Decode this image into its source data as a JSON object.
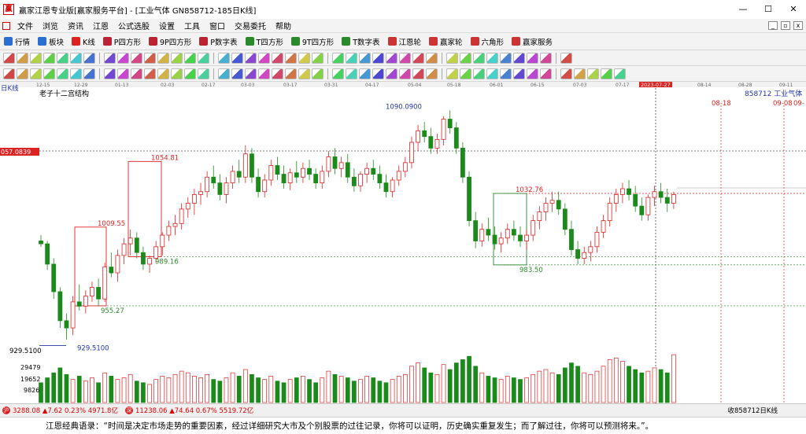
{
  "window": {
    "title": "赢家江恩专业版[赢家服务平台] - [工业气体  GN858712-185日K线]"
  },
  "menu": [
    "文件",
    "浏览",
    "资讯",
    "江恩",
    "公式选股",
    "设置",
    "工具",
    "窗口",
    "交易委托",
    "帮助"
  ],
  "toolbar": [
    {
      "label": "行情",
      "color": "#2a6fd1"
    },
    {
      "label": "板块",
      "color": "#2a6fd1"
    },
    {
      "label": "K线",
      "color": "#d22"
    },
    {
      "label": "P四方形",
      "color": "#b23"
    },
    {
      "label": "9P四方形",
      "color": "#b23"
    },
    {
      "label": "P数字表",
      "color": "#b23"
    },
    {
      "label": "T四方形",
      "color": "#2a8a2a"
    },
    {
      "label": "9T四方形",
      "color": "#2a8a2a"
    },
    {
      "label": "T数字表",
      "color": "#2a8a2a"
    },
    {
      "label": "江恩轮",
      "color": "#c33"
    },
    {
      "label": "赢家轮",
      "color": "#c33"
    },
    {
      "label": "六角形",
      "color": "#c33"
    },
    {
      "label": "赢家服务",
      "color": "#c33"
    }
  ],
  "chart_data": {
    "type": "candlestick",
    "period_label": "日K线",
    "indicator_title": "老子十二宫结构",
    "symbol_info": "858712  工业气体",
    "date_ticks": [
      "12-15",
      "12-29",
      "01-13",
      "02-03",
      "02-17",
      "03-03",
      "03-17",
      "03-31",
      "04-17",
      "05-04",
      "05-18",
      "06-01",
      "06-15",
      "07-03",
      "07-17",
      "2023-07-27",
      "08-14",
      "08-28",
      "09-11"
    ],
    "future_labels": [
      "08-18",
      "09-08",
      "09-"
    ],
    "price_scale": {
      "min": 920,
      "max": 1100
    },
    "volume_ticks": [
      "29479",
      "19652",
      "9826"
    ],
    "axis_tags": {
      "price_cursor": "057.0839",
      "low_label": "929.5100"
    },
    "annotations": [
      {
        "text": "1090.0900",
        "value": 1090.09,
        "color": "#2233aa"
      },
      {
        "text": "1054.81",
        "value": 1054.81,
        "color": "#d22"
      },
      {
        "text": "1032.76",
        "value": 1032.76,
        "color": "#d22"
      },
      {
        "text": "1009.55",
        "value": 1009.55,
        "color": "#d22"
      },
      {
        "text": "989.16",
        "value": 989.16,
        "color": "#2a8a2a"
      },
      {
        "text": "983.50",
        "value": 983.5,
        "color": "#2a8a2a"
      },
      {
        "text": "955.27",
        "value": 955.27,
        "color": "#2a8a2a"
      },
      {
        "text": "929.5100",
        "value": 929.51,
        "color": "#2233aa"
      }
    ],
    "ohlc": [
      [
        1000,
        1004,
        996,
        998
      ],
      [
        998,
        1000,
        980,
        984
      ],
      [
        984,
        988,
        960,
        965
      ],
      [
        965,
        968,
        940,
        945
      ],
      [
        945,
        950,
        932,
        940
      ],
      [
        940,
        962,
        935,
        958
      ],
      [
        958,
        970,
        952,
        955
      ],
      [
        955,
        966,
        950,
        962
      ],
      [
        962,
        972,
        958,
        968
      ],
      [
        968,
        974,
        955,
        960
      ],
      [
        960,
        985,
        958,
        982
      ],
      [
        982,
        992,
        975,
        978
      ],
      [
        978,
        994,
        972,
        990
      ],
      [
        990,
        1002,
        984,
        998
      ],
      [
        998,
        1008,
        990,
        1002
      ],
      [
        1002,
        1006,
        988,
        992
      ],
      [
        992,
        996,
        980,
        984
      ],
      [
        984,
        990,
        978,
        988
      ],
      [
        988,
        1000,
        985,
        996
      ],
      [
        996,
        1006,
        990,
        1004
      ],
      [
        1004,
        1014,
        1000,
        1010
      ],
      [
        1010,
        1018,
        1004,
        1012
      ],
      [
        1012,
        1026,
        1008,
        1022
      ],
      [
        1022,
        1030,
        1016,
        1026
      ],
      [
        1026,
        1036,
        1018,
        1032
      ],
      [
        1032,
        1040,
        1025,
        1034
      ],
      [
        1034,
        1048,
        1030,
        1044
      ],
      [
        1044,
        1052,
        1036,
        1040
      ],
      [
        1040,
        1046,
        1028,
        1032
      ],
      [
        1032,
        1044,
        1026,
        1040
      ],
      [
        1040,
        1052,
        1036,
        1048
      ],
      [
        1048,
        1056,
        1040,
        1044
      ],
      [
        1044,
        1066,
        1040,
        1060
      ],
      [
        1060,
        1064,
        1040,
        1044
      ],
      [
        1044,
        1050,
        1030,
        1034
      ],
      [
        1034,
        1046,
        1030,
        1042
      ],
      [
        1042,
        1056,
        1038,
        1052
      ],
      [
        1052,
        1058,
        1042,
        1046
      ],
      [
        1046,
        1052,
        1036,
        1040
      ],
      [
        1040,
        1050,
        1035,
        1047
      ],
      [
        1047,
        1055,
        1040,
        1044
      ],
      [
        1044,
        1054,
        1040,
        1050
      ],
      [
        1050,
        1056,
        1042,
        1046
      ],
      [
        1046,
        1050,
        1036,
        1040
      ],
      [
        1040,
        1052,
        1036,
        1048
      ],
      [
        1048,
        1062,
        1044,
        1058
      ],
      [
        1058,
        1064,
        1046,
        1050
      ],
      [
        1050,
        1058,
        1044,
        1054
      ],
      [
        1054,
        1060,
        1040,
        1044
      ],
      [
        1044,
        1050,
        1034,
        1038
      ],
      [
        1038,
        1048,
        1034,
        1046
      ],
      [
        1046,
        1054,
        1040,
        1050
      ],
      [
        1050,
        1056,
        1042,
        1046
      ],
      [
        1046,
        1052,
        1036,
        1040
      ],
      [
        1040,
        1046,
        1030,
        1034
      ],
      [
        1034,
        1044,
        1030,
        1042
      ],
      [
        1042,
        1052,
        1038,
        1048
      ],
      [
        1048,
        1058,
        1044,
        1054
      ],
      [
        1054,
        1072,
        1050,
        1068
      ],
      [
        1068,
        1080,
        1062,
        1076
      ],
      [
        1076,
        1082,
        1068,
        1072
      ],
      [
        1072,
        1078,
        1060,
        1064
      ],
      [
        1064,
        1074,
        1060,
        1070
      ],
      [
        1070,
        1086,
        1066,
        1084
      ],
      [
        1084,
        1090,
        1074,
        1078
      ],
      [
        1078,
        1082,
        1060,
        1064
      ],
      [
        1064,
        1068,
        1040,
        1044
      ],
      [
        1044,
        1048,
        1010,
        1014
      ],
      [
        1014,
        1020,
        995,
        1000
      ],
      [
        1000,
        1012,
        996,
        1008
      ],
      [
        1008,
        1016,
        1000,
        1004
      ],
      [
        1004,
        1010,
        994,
        998
      ],
      [
        998,
        1006,
        992,
        1002
      ],
      [
        1002,
        1012,
        998,
        1008
      ],
      [
        1008,
        1014,
        1000,
        1004
      ],
      [
        1004,
        1010,
        996,
        1000
      ],
      [
        1000,
        1008,
        994,
        1004
      ],
      [
        1004,
        1018,
        1000,
        1014
      ],
      [
        1014,
        1024,
        1008,
        1020
      ],
      [
        1020,
        1030,
        1014,
        1026
      ],
      [
        1026,
        1034,
        1020,
        1028
      ],
      [
        1028,
        1034,
        1018,
        1022
      ],
      [
        1022,
        1026,
        1004,
        1008
      ],
      [
        1008,
        1014,
        990,
        994
      ],
      [
        994,
        1000,
        984,
        988
      ],
      [
        988,
        996,
        984,
        992
      ],
      [
        992,
        1000,
        986,
        996
      ],
      [
        996,
        1010,
        992,
        1006
      ],
      [
        1006,
        1018,
        1002,
        1014
      ],
      [
        1014,
        1030,
        1010,
        1026
      ],
      [
        1026,
        1036,
        1020,
        1032
      ],
      [
        1032,
        1040,
        1026,
        1036
      ],
      [
        1036,
        1042,
        1028,
        1032
      ],
      [
        1032,
        1038,
        1020,
        1024
      ],
      [
        1024,
        1030,
        1014,
        1018
      ],
      [
        1018,
        1032,
        1014,
        1030
      ],
      [
        1030,
        1038,
        1024,
        1034
      ],
      [
        1034,
        1040,
        1026,
        1030
      ],
      [
        1030,
        1036,
        1020,
        1026
      ],
      [
        1026,
        1034,
        1022,
        1032
      ]
    ],
    "volumes": [
      12000,
      15000,
      18000,
      21000,
      17000,
      14000,
      16000,
      13000,
      15000,
      12000,
      18000,
      16000,
      14000,
      15000,
      17000,
      13000,
      12000,
      11000,
      14000,
      16000,
      15000,
      17000,
      19000,
      18000,
      16000,
      15000,
      17000,
      14000,
      13000,
      15000,
      18000,
      16000,
      20000,
      17000,
      15000,
      14000,
      16000,
      13000,
      12000,
      14000,
      15000,
      16000,
      14000,
      12000,
      15000,
      19000,
      17000,
      16000,
      15000,
      13000,
      14000,
      16000,
      15000,
      13000,
      12000,
      14000,
      16000,
      17000,
      22000,
      24000,
      21000,
      18000,
      17000,
      23000,
      20000,
      24000,
      26000,
      28000,
      22000,
      18000,
      16000,
      15000,
      14000,
      16000,
      15000,
      14000,
      15000,
      17000,
      19000,
      20000,
      18000,
      17000,
      21000,
      24000,
      22000,
      18000,
      17000,
      19000,
      22000,
      26000,
      27000,
      25000,
      22000,
      20000,
      18000,
      19000,
      21000,
      20000,
      18000,
      29000
    ]
  },
  "status": {
    "index1": "3288.08 ▲7.62 0.23% 4971.8亿",
    "index2": "11238.06 ▲74.64 0.67% 5519.72亿",
    "right_text": "收858712日K线"
  },
  "quote": "江恩经典语录：“时间是决定市场走势的重要因素，经过详细研究大市及个别股票的过往记录，你将可以证明，历史确实重复发生；而了解过往，你将可以预测将来。”。"
}
